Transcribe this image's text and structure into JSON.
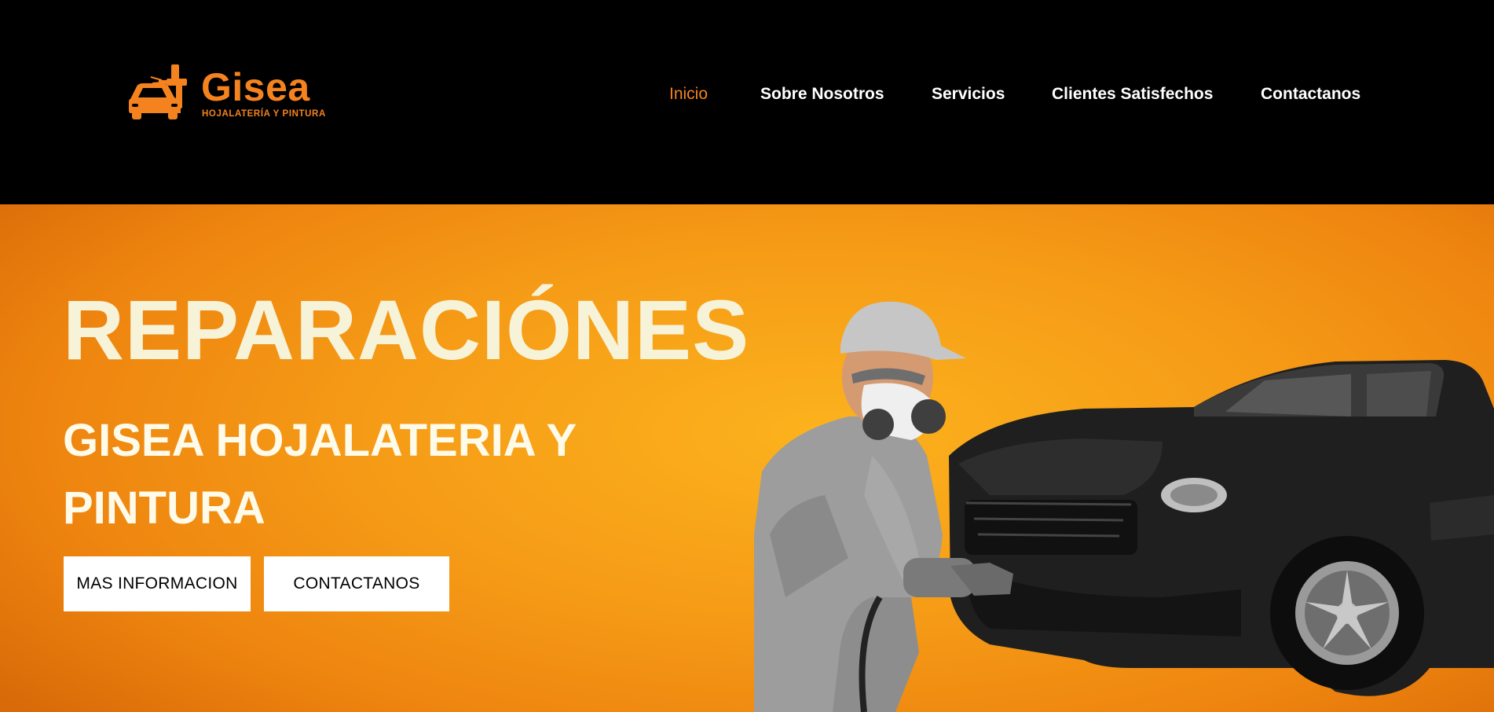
{
  "header": {
    "logo": {
      "title": "Gisea",
      "subtitle": "HOJALATERÍA Y PINTURA",
      "icon": "car-spray-gun-icon",
      "color": "#f4831f"
    },
    "nav": [
      {
        "label": "Inicio",
        "active": true
      },
      {
        "label": "Sobre Nosotros",
        "active": false
      },
      {
        "label": "Servicios",
        "active": false
      },
      {
        "label": "Clientes Satisfechos",
        "active": false
      },
      {
        "label": "Contactanos",
        "active": false
      }
    ]
  },
  "hero": {
    "title": "REPARACIÓNES",
    "subtitle": "GISEA HOJALATERIA Y PINTURA",
    "buttons": {
      "info": "MAS INFORMACION",
      "contact": "CONTACTANOS"
    },
    "image": "mechanic-with-damaged-black-car-illustration",
    "colors": {
      "accent": "#f4831f",
      "background_center": "#fcb21d",
      "background_edge": "#d86a08"
    }
  }
}
